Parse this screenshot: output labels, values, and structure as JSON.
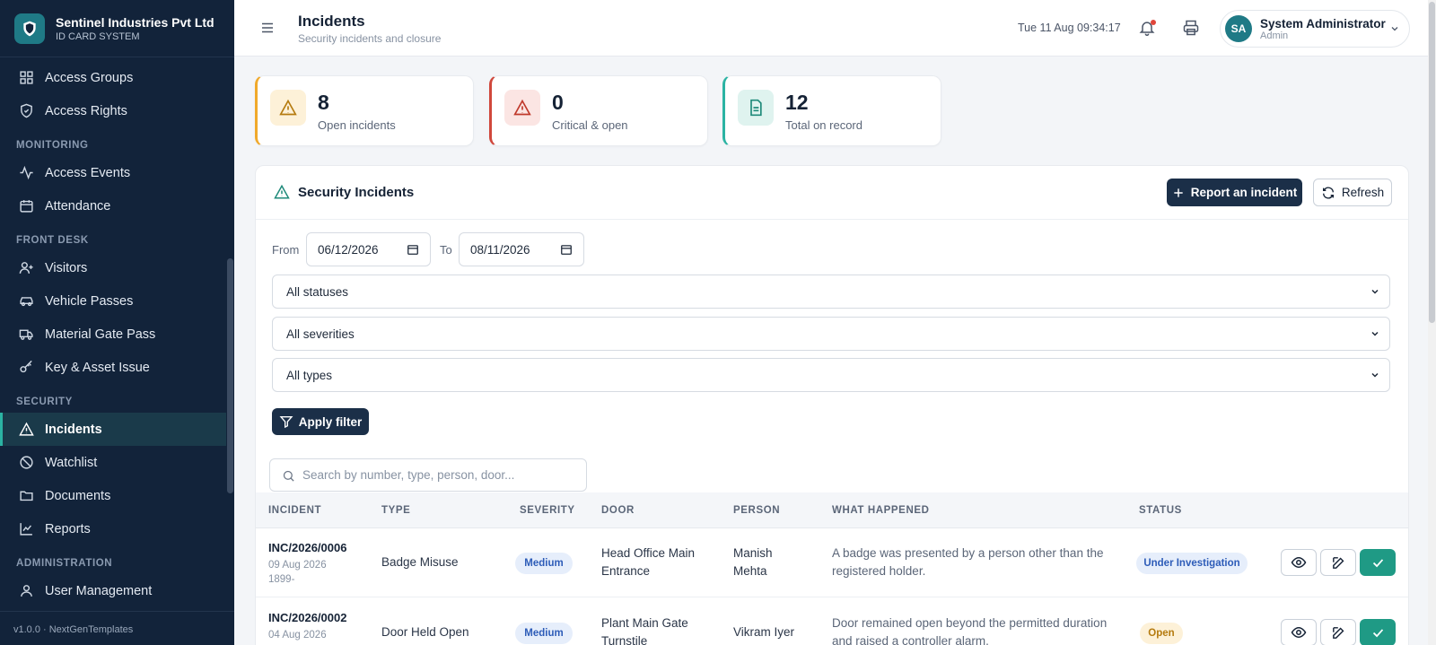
{
  "brand": {
    "name": "Sentinel Industries Pvt Ltd",
    "subtitle": "ID CARD SYSTEM"
  },
  "sidebar": {
    "items_top": [
      {
        "label": "Access Groups",
        "icon": "grid-icon"
      },
      {
        "label": "Access Rights",
        "icon": "shield-check-icon"
      }
    ],
    "sections": [
      {
        "title": "MONITORING",
        "items": [
          {
            "label": "Access Events",
            "icon": "activity-icon"
          },
          {
            "label": "Attendance",
            "icon": "calendar-icon"
          }
        ]
      },
      {
        "title": "FRONT DESK",
        "items": [
          {
            "label": "Visitors",
            "icon": "user-plus-icon"
          },
          {
            "label": "Vehicle Passes",
            "icon": "car-icon"
          },
          {
            "label": "Material Gate Pass",
            "icon": "truck-icon"
          },
          {
            "label": "Key & Asset Issue",
            "icon": "key-icon"
          }
        ]
      },
      {
        "title": "SECURITY",
        "items": [
          {
            "label": "Incidents",
            "icon": "warning-triangle-icon",
            "active": true
          },
          {
            "label": "Watchlist",
            "icon": "ban-icon"
          },
          {
            "label": "Documents",
            "icon": "folder-icon"
          },
          {
            "label": "Reports",
            "icon": "chart-line-icon"
          }
        ]
      },
      {
        "title": "ADMINISTRATION",
        "items": [
          {
            "label": "User Management",
            "icon": "user-icon"
          }
        ]
      }
    ],
    "version": "v1.0.0 · NextGenTemplates"
  },
  "header": {
    "title": "Incidents",
    "subtitle": "Security incidents and closure",
    "datetime": "Tue 11 Aug 09:34:17",
    "user": {
      "initials": "SA",
      "name": "System Administrator",
      "role": "Admin"
    }
  },
  "stats": [
    {
      "value": "8",
      "label": "Open incidents",
      "accent": "#f0a92b",
      "icon": "warning-triangle-icon"
    },
    {
      "value": "0",
      "label": "Critical & open",
      "accent": "#d0473b",
      "icon": "warning-triangle-icon"
    },
    {
      "value": "12",
      "label": "Total on record",
      "accent": "#2bb3a3",
      "icon": "document-icon"
    }
  ],
  "panel": {
    "title": "Security Incidents",
    "report_label": "Report an incident",
    "refresh_label": "Refresh"
  },
  "filters": {
    "from_label": "From",
    "from_value": "06/12/2026",
    "to_label": "To",
    "to_value": "08/11/2026",
    "status": "All statuses",
    "severity": "All severities",
    "type": "All types",
    "apply_label": "Apply filter",
    "search_placeholder": "Search by number, type, person, door..."
  },
  "table": {
    "columns": [
      "INCIDENT",
      "TYPE",
      "SEVERITY",
      "DOOR",
      "PERSON",
      "WHAT HAPPENED",
      "STATUS"
    ],
    "rows": [
      {
        "id": "INC/2026/0006",
        "date": "09 Aug 2026",
        "extra": "1899-",
        "type": "Badge Misuse",
        "severity": "Medium",
        "door_1": "Head Office Main",
        "door_2": "Entrance",
        "person_1": "Manish",
        "person_2": "Mehta",
        "what_1": "A badge was presented by a person other than the",
        "what_2": "registered holder.",
        "status": "Under Investigation"
      },
      {
        "id": "INC/2026/0002",
        "date": "04 Aug 2026",
        "extra": "",
        "type": "Door Held Open",
        "severity": "Medium",
        "door_1": "Plant Main Gate",
        "door_2": "Turnstile",
        "person_1": "Vikram Iyer",
        "person_2": "",
        "what_1": "Door remained open beyond the permitted duration",
        "what_2": "and raised a controller alarm.",
        "status": "Open"
      }
    ]
  }
}
